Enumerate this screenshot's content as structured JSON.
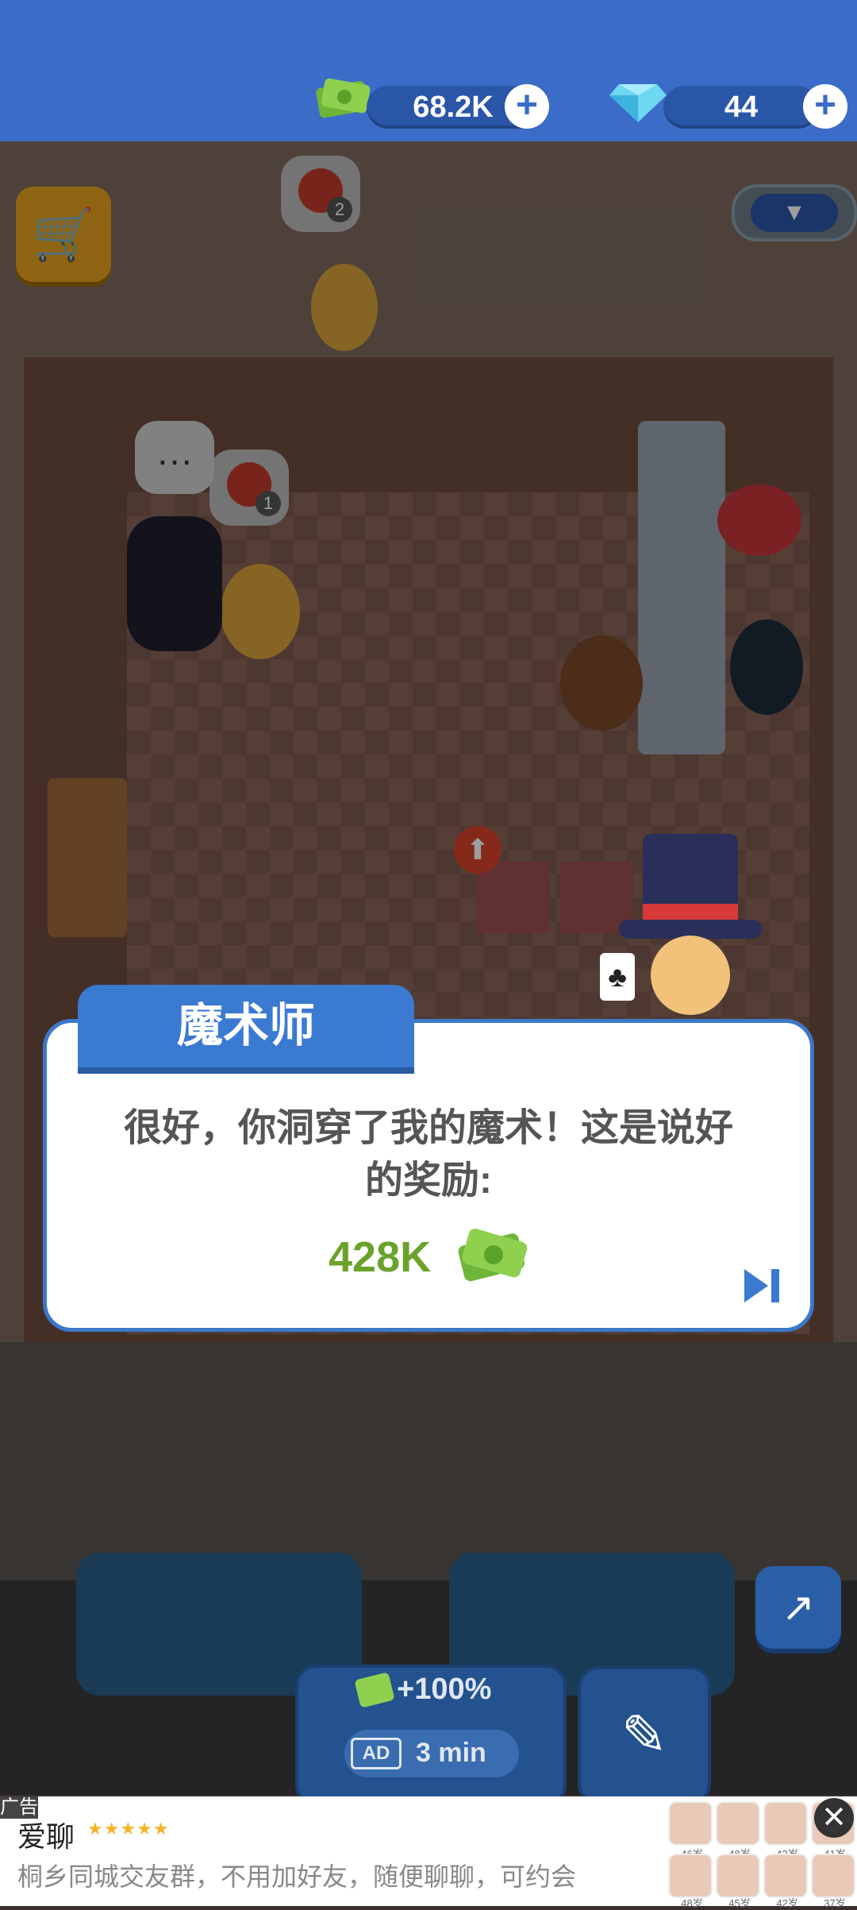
{
  "currency": {
    "cash_value": "68.2K",
    "gems_value": "44",
    "cash_icon": "cash-icon",
    "gem_icon": "diamond-icon"
  },
  "buttons": {
    "shop_icon": "shop-cart-icon",
    "dropdown_icon": "chevron-down-icon",
    "trend_icon": "trending-up-icon",
    "edit_icon": "pencil-icon"
  },
  "bubbles": {
    "order_1_count": "2",
    "order_2_count": "1",
    "typing": "…"
  },
  "boost": {
    "percent": "+100%",
    "ad_label": "AD",
    "duration": "3 min"
  },
  "dialog": {
    "speaker": "魔术师",
    "message_line1": "很好，你洞穿了我的魔术！这是说好",
    "message_line2": "的奖励:",
    "reward_amount": "428K"
  },
  "ad": {
    "tag": "广告",
    "title": "爱聊",
    "rating": "★★★★★",
    "description": "桐乡同城交友群，不用加好友，随便聊聊，可约会",
    "ages": [
      "46岁",
      "48岁",
      "43岁",
      "41岁",
      "48岁",
      "45岁",
      "42岁",
      "37岁"
    ]
  },
  "colors": {
    "topbar": "#3a6cc8",
    "dialog_border": "#3c78c9",
    "reward_green": "#6aa22c"
  }
}
